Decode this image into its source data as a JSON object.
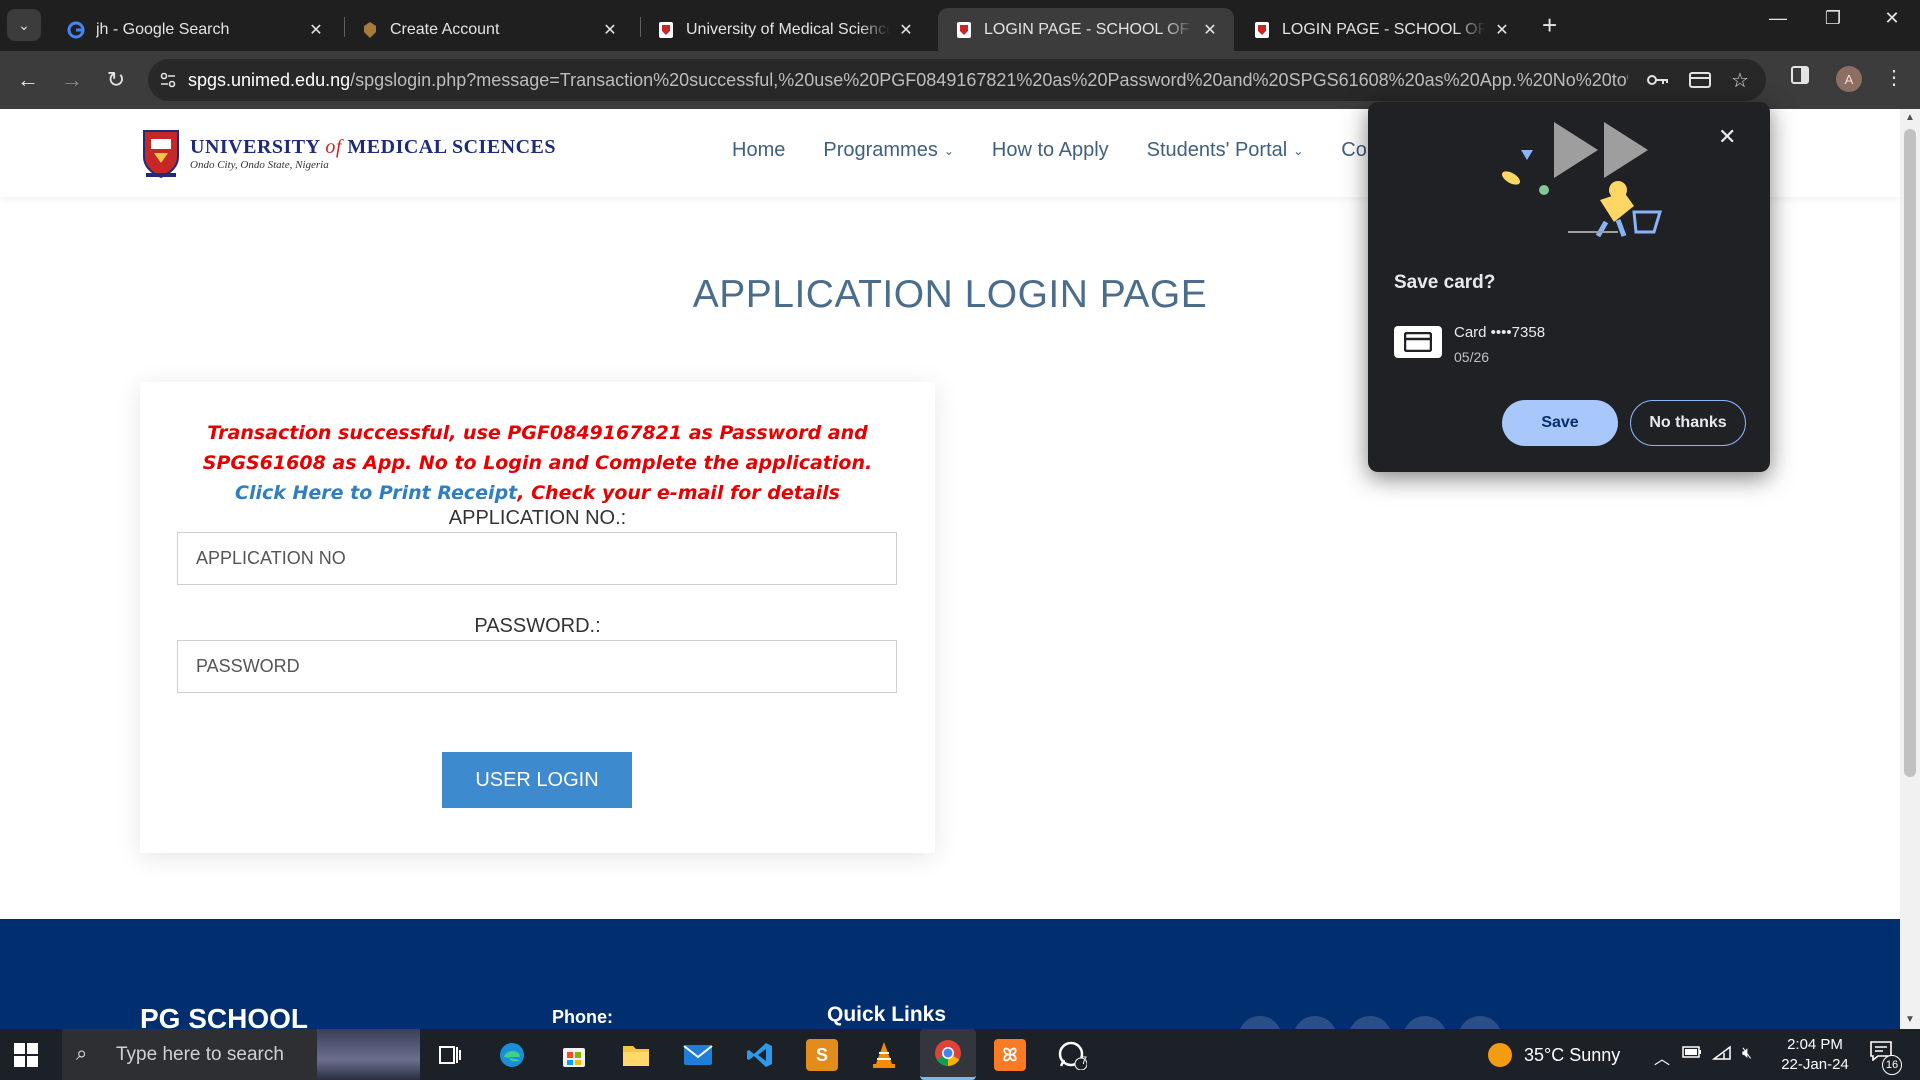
{
  "browser": {
    "tabs": [
      {
        "title": "jh - Google Search",
        "favicon": "google-icon",
        "active": false
      },
      {
        "title": "Create Account",
        "favicon": "crest-icon",
        "active": false
      },
      {
        "title": "University of Medical Sciences, O",
        "favicon": "unimed-icon",
        "active": false
      },
      {
        "title": "LOGIN PAGE - SCHOOL OF POS",
        "favicon": "unimed-icon",
        "active": true
      },
      {
        "title": "LOGIN PAGE - SCHOOL OF POS",
        "favicon": "unimed-icon",
        "active": false
      }
    ],
    "url_host": "spgs.unimed.edu.ng",
    "url_rest": "/spgslogin.php?message=Transaction%20successful,%20use%20PGF0849167821%20as%20Password%20and%20SPGS61608%20as%20App.%20No%20to%20Login%...",
    "profile_initial": "A"
  },
  "site": {
    "logo_name_1": "UNIVERSITY",
    "logo_of": "of",
    "logo_name_2": "MEDICAL  SCIENCES",
    "logo_sub": "Ondo City, Ondo State, Nigeria",
    "nav": [
      "Home",
      "Programmes",
      "How to Apply",
      "Students' Portal",
      "Co"
    ]
  },
  "login": {
    "title": "APPLICATION LOGIN PAGE",
    "message": "Transaction successful, use PGF0849167821 as Password and SPGS61608 as App. No to Login and Complete the application.",
    "receipt_link": "Click Here to Print Receipt",
    "receipt_suffix": ", Check your e-mail for details",
    "app_label": "APPLICATION NO.:",
    "app_placeholder": "APPLICATION NO",
    "pwd_label": "PASSWORD.:",
    "pwd_placeholder": "PASSWORD",
    "button": "USER LOGIN"
  },
  "footer": {
    "title": "PG SCHOOL",
    "phone_label": "Phone:",
    "quick_links": "Quick Links"
  },
  "popup": {
    "title": "Save card?",
    "card_name": "Card  ••••7358",
    "card_exp": "05/26",
    "save": "Save",
    "no_thanks": "No thanks"
  },
  "taskbar": {
    "search_placeholder": "Type here to search",
    "weather": "35°C  Sunny",
    "time": "2:04 PM",
    "date": "22-Jan-24",
    "notifications": "16",
    "whatsapp_badge": "7"
  },
  "colors": {
    "accent": "#3d8ace",
    "error": "#e60000",
    "footer": "#002e6e"
  }
}
